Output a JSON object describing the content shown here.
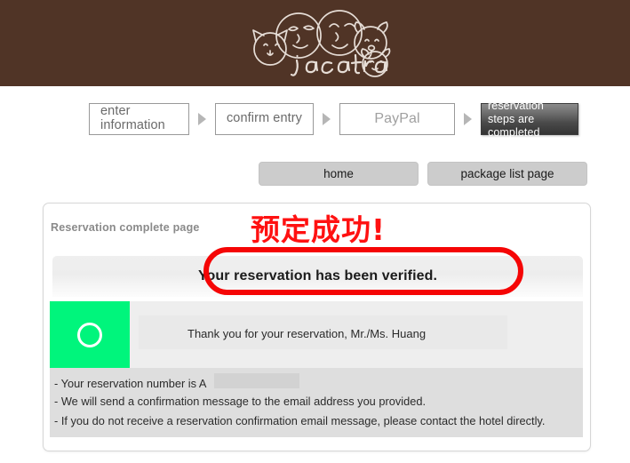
{
  "header": {
    "logo_name": "jacatra",
    "brand_color": "#503426"
  },
  "steps": {
    "items": [
      {
        "label": "enter information",
        "state": "inactive"
      },
      {
        "label": "confirm entry",
        "state": "inactive"
      },
      {
        "label": "PayPal",
        "state": "inactive"
      },
      {
        "label": "reservation steps are completed",
        "state": "active"
      }
    ],
    "separator_icon": "triangle-right-icon",
    "active_color": "#3c3c3c"
  },
  "nav_buttons": {
    "home_label": "home",
    "package_list_label": "package list page"
  },
  "card": {
    "title": "Reservation complete page",
    "annotation_cn": "预定成功!",
    "annotation_color": "#ff1111",
    "verified_message": "Your reservation has been verified.",
    "highlight_shape": "red-oval-annotation",
    "status_icon": "circle-outline-icon",
    "status_color": "#00f57c",
    "thanks_message": "Thank you for your reservation, Mr./Ms. Huang",
    "notes": [
      "- Your reservation number is A",
      "- We will send a confirmation message to the email address you provided.",
      "- If you do not receive a reservation confirmation email message, please contact the hotel directly."
    ],
    "redacted_value": ""
  }
}
